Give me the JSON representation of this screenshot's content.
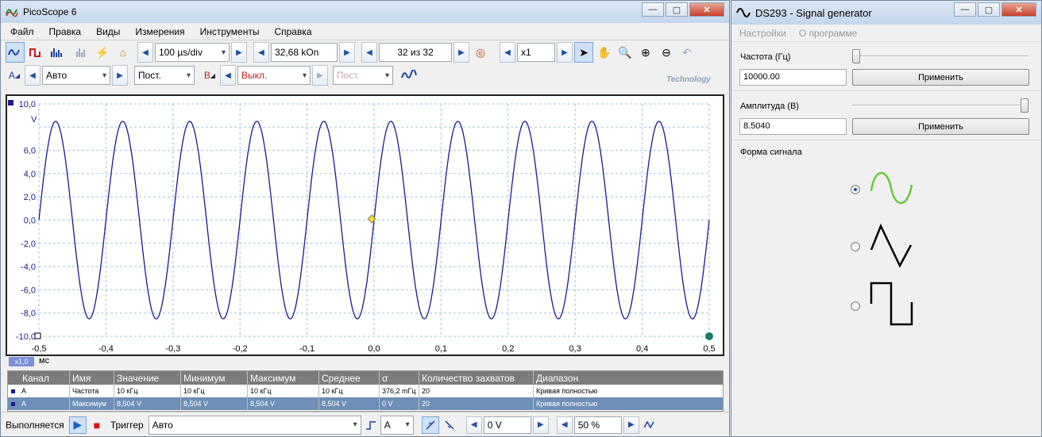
{
  "picoscope": {
    "title": "PicoScope 6",
    "menu": [
      "Файл",
      "Правка",
      "Виды",
      "Измерения",
      "Инструменты",
      "Справка"
    ],
    "toolbar1": {
      "timebase": "100 µs/div",
      "samples": "32,68 kOn",
      "buffer": "32 из 32",
      "zoom": "x1"
    },
    "toolbar2": {
      "channel_a_label": "A",
      "channel_a_range": "Авто",
      "channel_a_coupling": "Пост.",
      "channel_b_label": "B",
      "channel_b_range": "Выкл.",
      "channel_b_coupling": "Пост.",
      "watermark": "Technology"
    },
    "scope": {
      "y_ticks": [
        "10,0",
        "6,0",
        "4,0",
        "2,0",
        "0,0",
        "-2,0",
        "-4,0",
        "-6,0",
        "-8,0",
        "-10,0"
      ],
      "y_unit": "V",
      "x_ticks": [
        "-0,5",
        "-0,4",
        "-0,3",
        "-0,2",
        "-0,1",
        "0,0",
        "0,1",
        "0,2",
        "0,3",
        "0,4",
        "0,5"
      ],
      "x_unit": "мс",
      "zoom_badge": "x1,0",
      "waveform": {
        "amplitude_v": 8.5,
        "cycles": 10,
        "color": "#1a1a8c"
      }
    },
    "measurements": {
      "headers": [
        "Канал",
        "Имя",
        "Значение",
        "Минимум",
        "Максимум",
        "Среднее",
        "σ",
        "Количество захватов",
        "Диапазон"
      ],
      "rows": [
        [
          "A",
          "Частота",
          "10 кГц",
          "10 кГц",
          "10 кГц",
          "10 кГц",
          "376,2 mГц",
          "20",
          "Кривая полностью"
        ],
        [
          "A",
          "Максимум",
          "8,504 V",
          "8,504 V",
          "8,504 V",
          "8,504 V",
          "0 V",
          "20",
          "Кривая полностью"
        ]
      ]
    },
    "status": {
      "running": "Выполняется",
      "trigger_label": "Триггер",
      "trigger_mode": "Авто",
      "trigger_channel": "A",
      "threshold": "0 V",
      "pretrigger": "50 %"
    }
  },
  "siggen": {
    "title": "DS293 - Signal generator",
    "menu": [
      "Настройки",
      "О программе"
    ],
    "freq_label": "Частота (Гц)",
    "freq_value": "10000.00",
    "freq_slider": 0.0,
    "amp_label": "Амплитуда (В)",
    "amp_value": "8.5040",
    "amp_slider": 1.0,
    "apply_label": "Применить",
    "shape_label": "Форма сигнала",
    "selected_shape": "sine"
  }
}
